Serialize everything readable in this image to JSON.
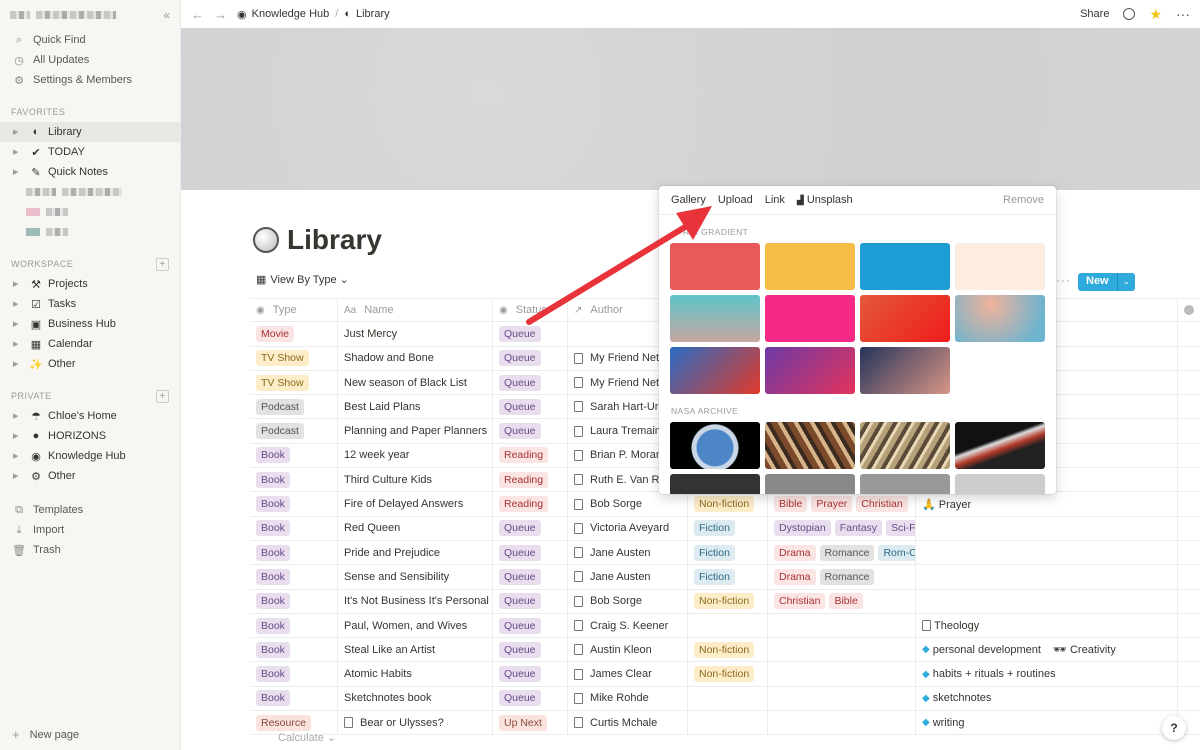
{
  "sidebar": {
    "top": [
      {
        "icon": "search-icon",
        "glyph": "⌕",
        "label": "Quick Find"
      },
      {
        "icon": "clock-icon",
        "glyph": "◷",
        "label": "All Updates"
      },
      {
        "icon": "gear-icon",
        "glyph": "⚙",
        "label": "Settings & Members"
      }
    ],
    "favorites_label": "FAVORITES",
    "favorites": [
      {
        "glyph": "◐",
        "label": "Library"
      },
      {
        "glyph": "✔",
        "label": "TODAY"
      },
      {
        "glyph": "✎",
        "label": "Quick Notes"
      }
    ],
    "workspace_label": "WORKSPACE",
    "workspace": [
      {
        "glyph": "⚒",
        "label": "Projects"
      },
      {
        "glyph": "☑",
        "label": "Tasks"
      },
      {
        "glyph": "▣",
        "label": "Business Hub"
      },
      {
        "glyph": "▦",
        "label": "Calendar"
      },
      {
        "glyph": "✨",
        "label": "Other"
      }
    ],
    "private_label": "PRIVATE",
    "private": [
      {
        "glyph": "☂",
        "label": "Chloe's Home"
      },
      {
        "glyph": "●",
        "label": "HORIZONS"
      },
      {
        "glyph": "◉",
        "label": "Knowledge Hub"
      },
      {
        "glyph": "⚙",
        "label": "Other"
      }
    ],
    "bottom": [
      {
        "glyph": "⧉",
        "label": "Templates"
      },
      {
        "glyph": "⤓",
        "label": "Import"
      },
      {
        "glyph": "🗑",
        "label": "Trash"
      }
    ],
    "new_page": "New page"
  },
  "topbar": {
    "crumb1": "Knowledge Hub",
    "crumb2": "Library",
    "share": "Share"
  },
  "page": {
    "title": "Library",
    "view": "View By Type",
    "new_label": "New",
    "calculate": "Calculate"
  },
  "table": {
    "headers": [
      "Type",
      "Name",
      "Status",
      "Author"
    ],
    "rows": [
      {
        "type": "Movie",
        "name": "Just Mercy",
        "status": "Queue",
        "author": "",
        "genre": [],
        "tags": [],
        "topics": []
      },
      {
        "type": "TV Show",
        "name": "Shadow and Bone",
        "status": "Queue",
        "author": "My Friend Net",
        "genre": [],
        "tags": [],
        "topics": []
      },
      {
        "type": "TV Show",
        "name": "New season of Black List",
        "status": "Queue",
        "author": "My Friend Net",
        "genre": [],
        "tags": [],
        "topics": []
      },
      {
        "type": "Podcast",
        "name": "Best Laid Plans",
        "status": "Queue",
        "author": "Sarah Hart-Ur",
        "genre": [],
        "tags": [],
        "topics": []
      },
      {
        "type": "Podcast",
        "name": "Planning and Paper Planners",
        "status": "Queue",
        "author": "Laura Tremain",
        "genre": [],
        "tags": [],
        "topics": []
      },
      {
        "type": "Book",
        "name": "12 week year",
        "status": "Reading",
        "author": "Brian P. Moran",
        "genre": [],
        "tags": [],
        "topics": []
      },
      {
        "type": "Book",
        "name": "Third Culture Kids",
        "status": "Reading",
        "author": "Ruth E. Van Re",
        "genre": [],
        "tags": [],
        "topics": []
      },
      {
        "type": "Book",
        "name": "Fire of Delayed Answers",
        "status": "Reading",
        "author": "Bob Sorge",
        "genre": [
          "Non-fiction"
        ],
        "tags": [
          "Bible",
          "Prayer",
          "Christian"
        ],
        "topics": [
          "🙏 Prayer"
        ]
      },
      {
        "type": "Book",
        "name": "Red Queen",
        "status": "Queue",
        "author": "Victoria Aveyard",
        "genre": [
          "Fiction"
        ],
        "tags": [
          "Dystopian",
          "Fantasy",
          "Sci-Fi"
        ],
        "topics": []
      },
      {
        "type": "Book",
        "name": "Pride and Prejudice",
        "status": "Queue",
        "author": "Jane Austen",
        "genre": [
          "Fiction"
        ],
        "tags": [
          "Drama",
          "Romance",
          "Rom-Co"
        ],
        "topics": []
      },
      {
        "type": "Book",
        "name": "Sense and Sensibility",
        "status": "Queue",
        "author": "Jane Austen",
        "genre": [
          "Fiction"
        ],
        "tags": [
          "Drama",
          "Romance"
        ],
        "topics": []
      },
      {
        "type": "Book",
        "name": "It's Not Business It's Personal",
        "status": "Queue",
        "author": "Bob Sorge",
        "genre": [
          "Non-fiction"
        ],
        "tags": [
          "Christian",
          "Bible"
        ],
        "topics": []
      },
      {
        "type": "Book",
        "name": "Paul, Women, and Wives",
        "status": "Queue",
        "author": "Craig S. Keener",
        "genre": [],
        "tags": [],
        "topics": [
          "Theology"
        ]
      },
      {
        "type": "Book",
        "name": "Steal Like an Artist",
        "status": "Queue",
        "author": "Austin Kleon",
        "genre": [
          "Non-fiction"
        ],
        "tags": [],
        "topics": [
          "personal development",
          "🕶 Creativity"
        ]
      },
      {
        "type": "Book",
        "name": "Atomic Habits",
        "status": "Queue",
        "author": "James Clear",
        "genre": [
          "Non-fiction"
        ],
        "tags": [],
        "topics": [
          "habits + rituals + routines"
        ]
      },
      {
        "type": "Book",
        "name": "Sketchnotes book",
        "status": "Queue",
        "author": "Mike Rohde",
        "genre": [],
        "tags": [],
        "topics": [
          "sketchnotes"
        ]
      },
      {
        "type": "Resource",
        "name": "Bear or Ulysses?",
        "status": "Up Next",
        "author": "Curtis Mchale",
        "genre": [],
        "tags": [],
        "topics": [
          "writing"
        ]
      }
    ]
  },
  "popover": {
    "tabs": [
      "Gallery",
      "Upload",
      "Link",
      "Unsplash"
    ],
    "remove": "Remove",
    "section1": "R & GRADIENT",
    "section2": "NASA ARCHIVE"
  },
  "colors": {
    "accent": "#2eaadc",
    "arrow": "#e8333a"
  }
}
